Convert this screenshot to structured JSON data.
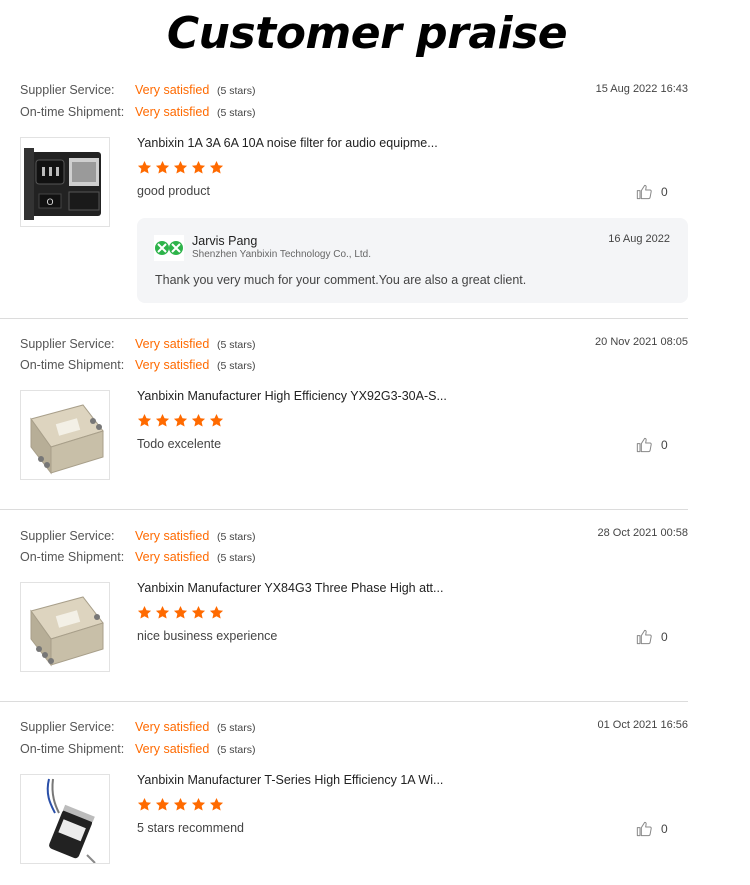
{
  "page": {
    "title": "Customer praise"
  },
  "labels": {
    "supplier_service": "Supplier Service:",
    "shipment": "On-time Shipment:"
  },
  "reviews": [
    {
      "supplier_rating": "Very satisfied",
      "supplier_stars": "(5 stars)",
      "shipment_rating": "Very satisfied",
      "shipment_stars": "(5 stars)",
      "date": "15 Aug 2022 16:43",
      "product": "Yanbixin 1A 3A 6A 10A noise filter for audio equipme...",
      "rating_stars": 5,
      "comment": "good product",
      "likes": "0",
      "reply": {
        "name": "Jarvis Pang",
        "company": "Shenzhen Yanbixin Technology Co., Ltd.",
        "date": "16 Aug 2022",
        "text": "Thank you very much  for your comment.You are also a great client."
      }
    },
    {
      "supplier_rating": "Very satisfied",
      "supplier_stars": "(5 stars)",
      "shipment_rating": "Very satisfied",
      "shipment_stars": "(5 stars)",
      "date": "20 Nov 2021 08:05",
      "product": "Yanbixin Manufacturer High Efficiency YX92G3-30A-S...",
      "rating_stars": 5,
      "comment": "Todo excelente",
      "likes": "0"
    },
    {
      "supplier_rating": "Very satisfied",
      "supplier_stars": "(5 stars)",
      "shipment_rating": "Very satisfied",
      "shipment_stars": "(5 stars)",
      "date": "28 Oct 2021 00:58",
      "product": "Yanbixin Manufacturer YX84G3 Three Phase High att...",
      "rating_stars": 5,
      "comment": "nice business experience",
      "likes": "0"
    },
    {
      "supplier_rating": "Very satisfied",
      "supplier_stars": "(5 stars)",
      "shipment_rating": "Very satisfied",
      "shipment_stars": "(5 stars)",
      "date": "01 Oct 2021 16:56",
      "product": "Yanbixin Manufacturer T-Series High Efficiency 1A Wi...",
      "rating_stars": 5,
      "comment": "5 stars recommend",
      "likes": "0"
    }
  ],
  "colors": {
    "accent": "#ff6a00",
    "reply_bg": "#f4f5f7",
    "separator": "#dcdcdc"
  },
  "icons": {
    "rating": "star-icon",
    "like": "thumbs-up-icon"
  }
}
